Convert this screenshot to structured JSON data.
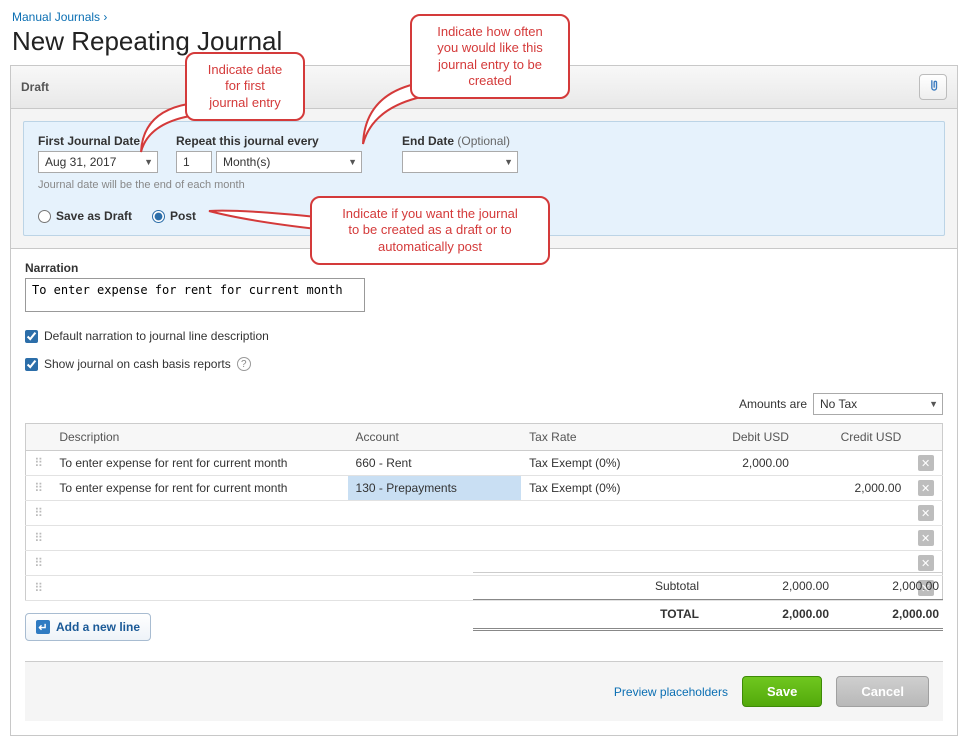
{
  "breadcrumb": {
    "parent": "Manual Journals",
    "arrow": "›"
  },
  "page_title": "New Repeating Journal",
  "panel": {
    "status": "Draft"
  },
  "schedule": {
    "first_date_label": "First Journal Date",
    "first_date_value": "Aug 31, 2017",
    "repeat_label": "Repeat this journal every",
    "repeat_count": "1",
    "repeat_unit": "Month(s)",
    "end_date_label": "End Date",
    "end_date_optional": "(Optional)",
    "end_date_value": "",
    "hint": "Journal date will be the end of each month",
    "save_draft_label": "Save as Draft",
    "post_label": "Post"
  },
  "narration": {
    "label": "Narration",
    "value": "To enter expense for rent for current month",
    "default_checkbox_label": "Default narration to journal line description",
    "cash_checkbox_label": "Show journal on cash basis reports"
  },
  "amounts_are": {
    "label": "Amounts are",
    "value": "No Tax"
  },
  "table": {
    "headers": {
      "description": "Description",
      "account": "Account",
      "tax_rate": "Tax Rate",
      "debit": "Debit USD",
      "credit": "Credit USD"
    },
    "rows": [
      {
        "description": "To enter expense for rent for current month",
        "account": "660 - Rent",
        "tax_rate": "Tax Exempt (0%)",
        "debit": "2,000.00",
        "credit": ""
      },
      {
        "description": "To enter expense for rent for current month",
        "account": "130 - Prepayments",
        "tax_rate": "Tax Exempt (0%)",
        "debit": "",
        "credit": "2,000.00",
        "highlight_account": true
      },
      {
        "description": "",
        "account": "",
        "tax_rate": "",
        "debit": "",
        "credit": ""
      },
      {
        "description": "",
        "account": "",
        "tax_rate": "",
        "debit": "",
        "credit": ""
      },
      {
        "description": "",
        "account": "",
        "tax_rate": "",
        "debit": "",
        "credit": ""
      },
      {
        "description": "",
        "account": "",
        "tax_rate": "",
        "debit": "",
        "credit": ""
      }
    ]
  },
  "add_line_label": "Add a new line",
  "totals": {
    "subtotal_label": "Subtotal",
    "subtotal_debit": "2,000.00",
    "subtotal_credit": "2,000.00",
    "total_label": "TOTAL",
    "total_debit": "2,000.00",
    "total_credit": "2,000.00"
  },
  "footer": {
    "preview_label": "Preview placeholders",
    "save_label": "Save",
    "cancel_label": "Cancel"
  },
  "callouts": {
    "date": "Indicate date\nfor first\njournal entry",
    "repeat": "Indicate how often\nyou would like this\njournal entry to be\ncreated",
    "post": "Indicate if you want the journal\nto be created as a draft or to\nautomatically post"
  }
}
